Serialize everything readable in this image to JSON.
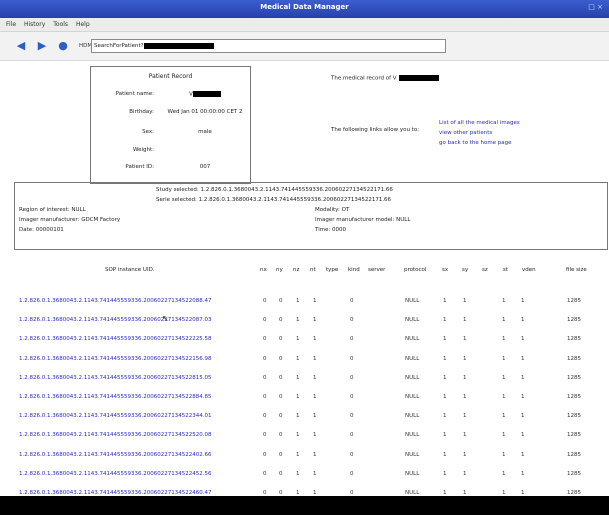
{
  "window": {
    "title": "Medical Data Manager",
    "controls": "□ ×"
  },
  "menu": [
    "File",
    "History",
    "Tools",
    "Help"
  ],
  "nav": {
    "back_icon": "◀",
    "forward_icon": "▶",
    "reload_icon": "●",
    "address_label": "HDM:",
    "address_value": "SearchForPatient?"
  },
  "record": {
    "title": "Patient Record",
    "fields": [
      {
        "k": "Patient name:",
        "v": "V"
      },
      {
        "k": "Birthday:",
        "v": "Wed Jan 01 00:00:00 CET 2"
      },
      {
        "k": "Sex:",
        "v": "male"
      },
      {
        "k": "Weight:",
        "v": ""
      },
      {
        "k": "Patient ID:",
        "v": "007"
      }
    ]
  },
  "right": {
    "medical_record_of": "The medical record of V",
    "follow_text": "The following links allow you to:",
    "links": [
      "List of all the medical images",
      "view other patients",
      "go back to the home page"
    ]
  },
  "study": {
    "study_selected": "Study selected:  1.2.826.0.1.3680043.2.1143.741445559336.20060227134522171.66",
    "serie_selected": "Serie selected:  1.2.826.0.1.3680043.2.1143.741445559336.20060227134522171.66",
    "region": "Region of interest: NULL",
    "manufacturer": "Imager manufacturer: GDCM Factory",
    "date": "Date: 00000101",
    "modality": "Modality: OT",
    "model": "Imager manufacturer model: NULL",
    "time": "Time: 0000"
  },
  "table": {
    "headers": [
      "SOP instance UID.",
      "nx",
      "ny",
      "nz",
      "nt",
      "type",
      "kind",
      "server",
      "protocol",
      "sx",
      "sy",
      "sz",
      "st",
      "vden",
      "file size"
    ],
    "rows": [
      {
        "uid": "1.2.826.0.1.3680043.2.1143.741445559336.20060227134522088.47",
        "nx": "0",
        "ny": "0",
        "nz": "1",
        "nt": "1",
        "type": "",
        "kind": "0",
        "server": "",
        "protocol": "NULL",
        "sx": "1",
        "sy": "1",
        "sz": "",
        "st": "1",
        "vden": "1",
        "size": "1285"
      },
      {
        "uid": "1.2.826.0.1.3680043.2.1143.741445559336.20060227134522087.03",
        "nx": "0",
        "ny": "0",
        "nz": "1",
        "nt": "1",
        "type": "",
        "kind": "0",
        "server": "",
        "protocol": "NULL",
        "sx": "1",
        "sy": "1",
        "sz": "",
        "st": "1",
        "vden": "1",
        "size": "1285"
      },
      {
        "uid": "1.2.826.0.1.3680043.2.1143.741445559336.20060227134522225.58",
        "nx": "0",
        "ny": "0",
        "nz": "1",
        "nt": "1",
        "type": "",
        "kind": "0",
        "server": "",
        "protocol": "NULL",
        "sx": "1",
        "sy": "1",
        "sz": "",
        "st": "1",
        "vden": "1",
        "size": "1285"
      },
      {
        "uid": "1.2.826.0.1.3680043.2.1143.741445559336.20060227134522156.98",
        "nx": "0",
        "ny": "0",
        "nz": "1",
        "nt": "1",
        "type": "",
        "kind": "0",
        "server": "",
        "protocol": "NULL",
        "sx": "1",
        "sy": "1",
        "sz": "",
        "st": "1",
        "vden": "1",
        "size": "1285"
      },
      {
        "uid": "1.2.826.0.1.3680043.2.1143.741445559336.20060227134522815.05",
        "nx": "0",
        "ny": "0",
        "nz": "1",
        "nt": "1",
        "type": "",
        "kind": "0",
        "server": "",
        "protocol": "NULL",
        "sx": "1",
        "sy": "1",
        "sz": "",
        "st": "1",
        "vden": "1",
        "size": "1285"
      },
      {
        "uid": "1.2.826.0.1.3680043.2.1143.741445559336.20060227134522884.85",
        "nx": "0",
        "ny": "0",
        "nz": "1",
        "nt": "1",
        "type": "",
        "kind": "0",
        "server": "",
        "protocol": "NULL",
        "sx": "1",
        "sy": "1",
        "sz": "",
        "st": "1",
        "vden": "1",
        "size": "1285"
      },
      {
        "uid": "1.2.826.0.1.3680043.2.1143.741445559336.20060227134522344.01",
        "nx": "0",
        "ny": "0",
        "nz": "1",
        "nt": "1",
        "type": "",
        "kind": "0",
        "server": "",
        "protocol": "NULL",
        "sx": "1",
        "sy": "1",
        "sz": "",
        "st": "1",
        "vden": "1",
        "size": "1285"
      },
      {
        "uid": "1.2.826.0.1.3680043.2.1143.741445559336.20060227134522520.08",
        "nx": "0",
        "ny": "0",
        "nz": "1",
        "nt": "1",
        "type": "",
        "kind": "0",
        "server": "",
        "protocol": "NULL",
        "sx": "1",
        "sy": "1",
        "sz": "",
        "st": "1",
        "vden": "1",
        "size": "1285"
      },
      {
        "uid": "1.2.826.0.1.3680043.2.1143.741445559336.20060227134522402.66",
        "nx": "0",
        "ny": "0",
        "nz": "1",
        "nt": "1",
        "type": "",
        "kind": "0",
        "server": "",
        "protocol": "NULL",
        "sx": "1",
        "sy": "1",
        "sz": "",
        "st": "1",
        "vden": "1",
        "size": "1285"
      },
      {
        "uid": "1.2.826.0.1.3680043.2.1143.741445559336.20060227134522452.56",
        "nx": "0",
        "ny": "0",
        "nz": "1",
        "nt": "1",
        "type": "",
        "kind": "0",
        "server": "",
        "protocol": "NULL",
        "sx": "1",
        "sy": "1",
        "sz": "",
        "st": "1",
        "vden": "1",
        "size": "1285"
      },
      {
        "uid": "1.2.826.0.1.3680043.2.1143.741445559336.20060227134522460.47",
        "nx": "0",
        "ny": "0",
        "nz": "1",
        "nt": "1",
        "type": "",
        "kind": "0",
        "server": "",
        "protocol": "NULL",
        "sx": "1",
        "sy": "1",
        "sz": "",
        "st": "1",
        "vden": "1",
        "size": "1285"
      }
    ]
  }
}
